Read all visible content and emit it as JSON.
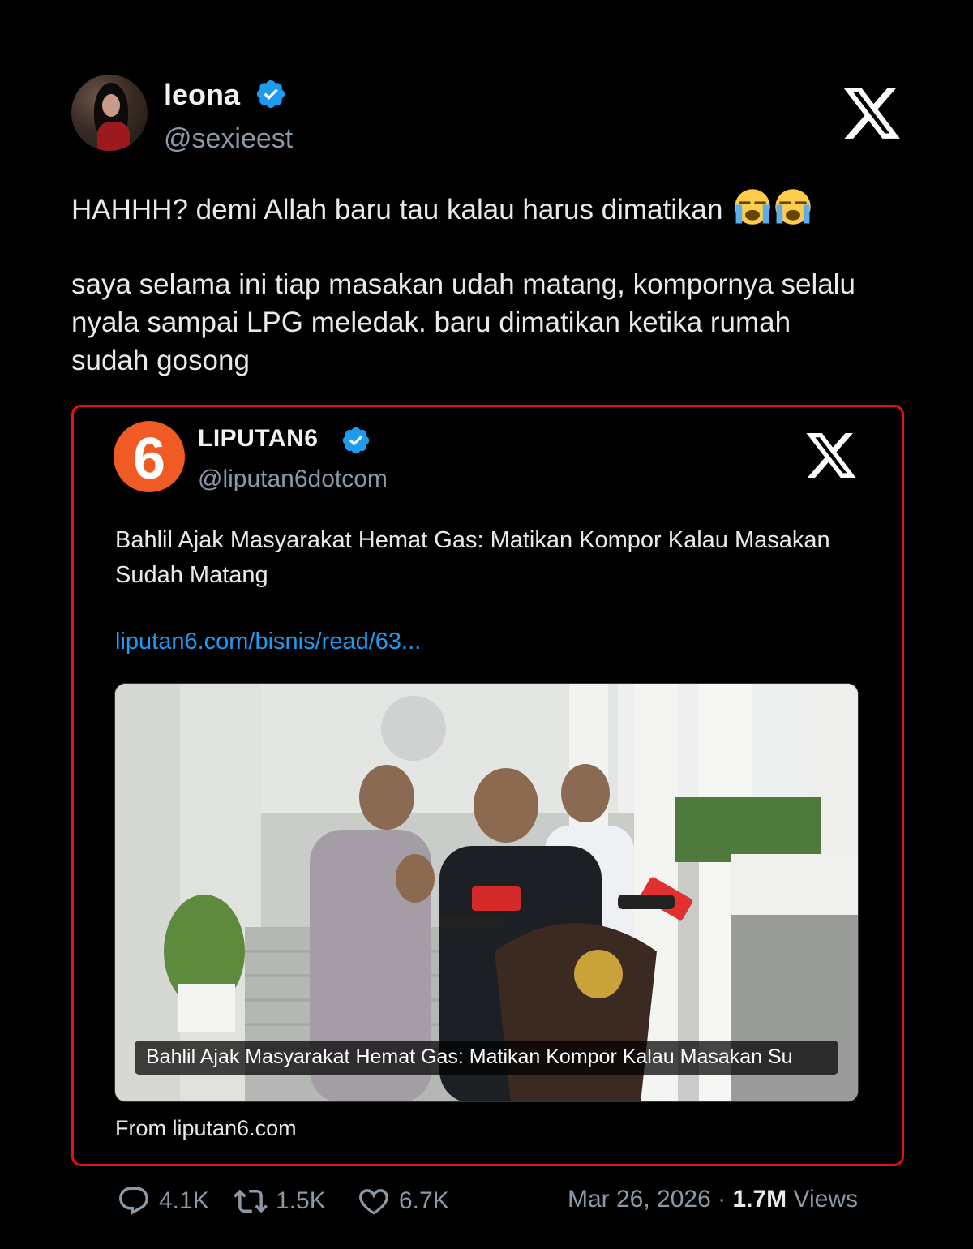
{
  "tweet": {
    "author_name": "leona",
    "author_handle": "@sexieest",
    "text_line1": "HAHHH? demi Allah baru tau kalau harus dimatikan",
    "text_para2": "saya selama ini tiap masakan udah matang, kompornya selalu nyala sampai LPG meledak. baru dimatikan ketika rumah sudah gosong",
    "emoji": [
      "loudly-crying-face",
      "loudly-crying-face"
    ]
  },
  "quote": {
    "author_name": "LIPUTAN6",
    "author_handle": "@liputan6dotcom",
    "logo_text": "6",
    "text": "Bahlil Ajak Masyarakat Hemat Gas: Matikan Kompor Kalau Masakan Sudah Matang",
    "link": "liputan6.com/bisnis/read/63...",
    "card_caption": "Bahlil Ajak Masyarakat Hemat Gas: Matikan Kompor Kalau Masakan Su",
    "from": "From liputan6.com"
  },
  "stats": {
    "replies": "4.1K",
    "reposts": "1.5K",
    "likes": "6.7K",
    "date": "Mar 26, 2026",
    "separator": "·",
    "views_count": "1.7M",
    "views_label": "Views"
  },
  "colors": {
    "background": "#000000",
    "verified_blue": "#1d9bf0",
    "link_blue": "#1d9bf0",
    "highlight_border": "#e01414",
    "liputan6_orange": "#f05a24"
  },
  "icons": [
    "x-logo-icon",
    "verified-badge-icon",
    "reply-icon",
    "repost-icon",
    "like-icon"
  ]
}
